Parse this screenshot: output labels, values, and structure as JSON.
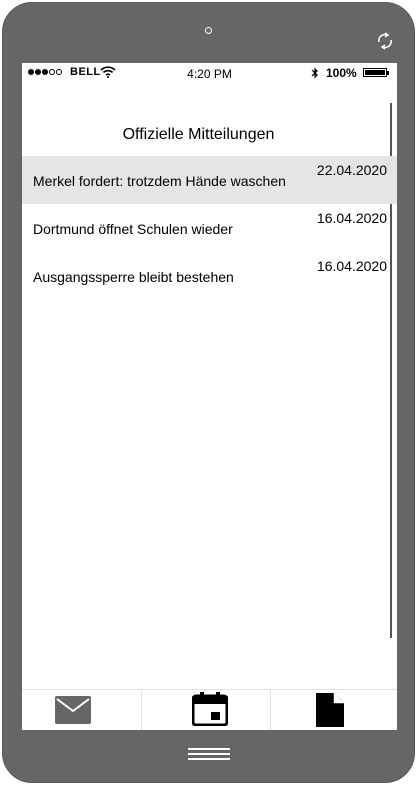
{
  "status_bar": {
    "carrier": "BELL",
    "time": "4:20 PM",
    "battery": "100%"
  },
  "header": {
    "title": "Offizielle Mitteilungen"
  },
  "announcements": [
    {
      "title": "Merkel fordert: trotzdem Hände waschen",
      "date": "22.04.2020",
      "selected": true
    },
    {
      "title": "Dortmund öffnet Schulen wieder",
      "date": "16.04.2020",
      "selected": false
    },
    {
      "title": "Ausgangssperre bleibt bestehen",
      "date": "16.04.2020",
      "selected": false
    }
  ],
  "tab_bar": {
    "tabs": [
      {
        "icon": "mail-icon"
      },
      {
        "icon": "calendar-icon"
      },
      {
        "icon": "document-icon"
      }
    ]
  },
  "colors": {
    "device_frame": "#666666",
    "selected_row": "#e5e5e5",
    "mail_icon": "#666666"
  }
}
